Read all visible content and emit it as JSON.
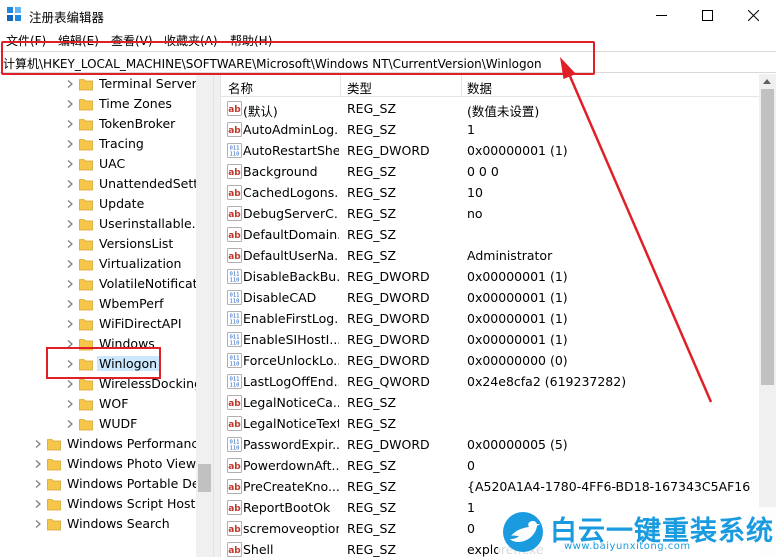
{
  "window": {
    "title": "注册表编辑器",
    "controls": {
      "minimize": "—",
      "maximize": "☐",
      "close": "✕"
    }
  },
  "menu": [
    {
      "label": "文件(F)"
    },
    {
      "label": "编辑(E)"
    },
    {
      "label": "查看(V)"
    },
    {
      "label": "收藏夹(A)"
    },
    {
      "label": "帮助(H)"
    }
  ],
  "address": {
    "path": "计算机\\HKEY_LOCAL_MACHINE\\SOFTWARE\\Microsoft\\Windows NT\\CurrentVersion\\Winlogon"
  },
  "tree": {
    "items": [
      {
        "label": "Terminal Server",
        "level": 2,
        "selected": false
      },
      {
        "label": "Time Zones",
        "level": 2,
        "selected": false
      },
      {
        "label": "TokenBroker",
        "level": 2,
        "selected": false
      },
      {
        "label": "Tracing",
        "level": 2,
        "selected": false
      },
      {
        "label": "UAC",
        "level": 2,
        "selected": false
      },
      {
        "label": "UnattendedSettin",
        "level": 2,
        "selected": false
      },
      {
        "label": "Update",
        "level": 2,
        "selected": false
      },
      {
        "label": "Userinstallable.d",
        "level": 2,
        "selected": false
      },
      {
        "label": "VersionsList",
        "level": 2,
        "selected": false
      },
      {
        "label": "Virtualization",
        "level": 2,
        "selected": false
      },
      {
        "label": "VolatileNotificati",
        "level": 2,
        "selected": false
      },
      {
        "label": "WbemPerf",
        "level": 2,
        "selected": false
      },
      {
        "label": "WiFiDirectAPI",
        "level": 2,
        "selected": false
      },
      {
        "label": "Windows",
        "level": 2,
        "selected": false
      },
      {
        "label": "Winlogon",
        "level": 2,
        "selected": true
      },
      {
        "label": "WirelessDocking",
        "level": 2,
        "selected": false
      },
      {
        "label": "WOF",
        "level": 2,
        "selected": false
      },
      {
        "label": "WUDF",
        "level": 2,
        "selected": false
      },
      {
        "label": "Windows Performance",
        "level": 1,
        "selected": false
      },
      {
        "label": "Windows Photo Viewe",
        "level": 1,
        "selected": false
      },
      {
        "label": "Windows Portable Dev",
        "level": 1,
        "selected": false
      },
      {
        "label": "Windows Script Host",
        "level": 1,
        "selected": false
      },
      {
        "label": "Windows Search",
        "level": 1,
        "selected": false
      }
    ]
  },
  "list": {
    "columns": {
      "name": "名称",
      "type": "类型",
      "data": "数据"
    },
    "rows": [
      {
        "name": "(默认)",
        "type": "REG_SZ",
        "data": "(数值未设置)",
        "icon": "string-value-icon"
      },
      {
        "name": "AutoAdminLog...",
        "type": "REG_SZ",
        "data": "1",
        "icon": "string-value-icon"
      },
      {
        "name": "AutoRestartShell",
        "type": "REG_DWORD",
        "data": "0x00000001 (1)",
        "icon": "binary-value-icon"
      },
      {
        "name": "Background",
        "type": "REG_SZ",
        "data": "0 0 0",
        "icon": "string-value-icon"
      },
      {
        "name": "CachedLogons...",
        "type": "REG_SZ",
        "data": "10",
        "icon": "string-value-icon"
      },
      {
        "name": "DebugServerC...",
        "type": "REG_SZ",
        "data": "no",
        "icon": "string-value-icon"
      },
      {
        "name": "DefaultDomain...",
        "type": "REG_SZ",
        "data": "",
        "icon": "string-value-icon"
      },
      {
        "name": "DefaultUserNa...",
        "type": "REG_SZ",
        "data": "Administrator",
        "icon": "string-value-icon"
      },
      {
        "name": "DisableBackBu...",
        "type": "REG_DWORD",
        "data": "0x00000001 (1)",
        "icon": "binary-value-icon"
      },
      {
        "name": "DisableCAD",
        "type": "REG_DWORD",
        "data": "0x00000001 (1)",
        "icon": "binary-value-icon"
      },
      {
        "name": "EnableFirstLog...",
        "type": "REG_DWORD",
        "data": "0x00000001 (1)",
        "icon": "binary-value-icon"
      },
      {
        "name": "EnableSIHostI...",
        "type": "REG_DWORD",
        "data": "0x00000001 (1)",
        "icon": "binary-value-icon"
      },
      {
        "name": "ForceUnlockLo...",
        "type": "REG_DWORD",
        "data": "0x00000000 (0)",
        "icon": "binary-value-icon"
      },
      {
        "name": "LastLogOffEnd...",
        "type": "REG_QWORD",
        "data": "0x24e8cfa2 (619237282)",
        "icon": "binary-value-icon"
      },
      {
        "name": "LegalNoticeCa...",
        "type": "REG_SZ",
        "data": "",
        "icon": "string-value-icon"
      },
      {
        "name": "LegalNoticeText",
        "type": "REG_SZ",
        "data": "",
        "icon": "string-value-icon"
      },
      {
        "name": "PasswordExpir...",
        "type": "REG_DWORD",
        "data": "0x00000005 (5)",
        "icon": "binary-value-icon"
      },
      {
        "name": "PowerdownAft...",
        "type": "REG_SZ",
        "data": "0",
        "icon": "string-value-icon"
      },
      {
        "name": "PreCreateKno...",
        "type": "REG_SZ",
        "data": "{A520A1A4-1780-4FF6-BD18-167343C5AF16}",
        "icon": "string-value-icon"
      },
      {
        "name": "ReportBootOk",
        "type": "REG_SZ",
        "data": "1",
        "icon": "string-value-icon"
      },
      {
        "name": "scremoveoption",
        "type": "REG_SZ",
        "data": "0",
        "icon": "string-value-icon"
      },
      {
        "name": "Shell",
        "type": "REG_SZ",
        "data": "explorer.exe",
        "icon": "string-value-icon"
      }
    ]
  },
  "watermark": {
    "brand": "白云一键重装系统",
    "url": "www.baiyunxitong.com"
  },
  "colors": {
    "annotation_red": "#e02027",
    "selection_blue": "#cce8ff",
    "folder_yellow": "#f5c649",
    "string_icon_red": "#c0392b",
    "binary_icon_blue": "#1f5fbf",
    "brand_blue": "#1a9be0"
  }
}
